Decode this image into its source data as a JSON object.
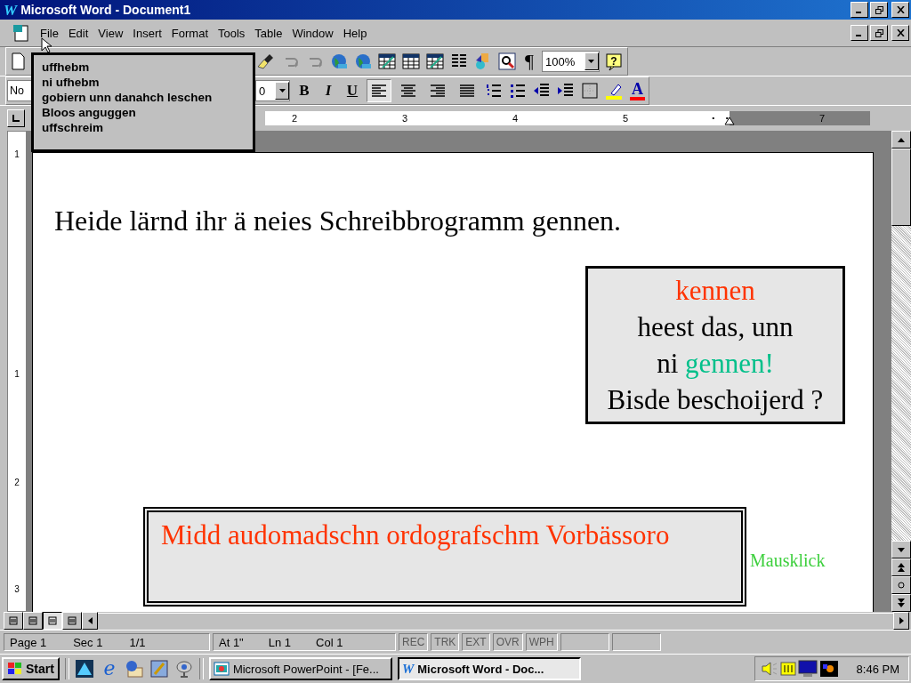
{
  "window": {
    "title": "Microsoft Word - Document1"
  },
  "logo": "W",
  "menu": [
    {
      "label": "File"
    },
    {
      "label": "Edit"
    },
    {
      "label": "View"
    },
    {
      "label": "Insert"
    },
    {
      "label": "Format"
    },
    {
      "label": "Tools"
    },
    {
      "label": "Table"
    },
    {
      "label": "Window"
    },
    {
      "label": "Help"
    }
  ],
  "toolbar": {
    "pilcrow": "¶",
    "zoom": "100%",
    "help": "?"
  },
  "formatting": {
    "style": "No",
    "size": "0",
    "bold": "B",
    "italic": "I",
    "underline": "U",
    "font_color_letter": "A",
    "align": [
      {
        "selected": true
      },
      {
        "selected": false
      },
      {
        "selected": false
      },
      {
        "selected": false
      }
    ]
  },
  "popup": {
    "lines": [
      "uffhebm",
      "ni ufhebm",
      "gobiern unn danahch leschen",
      "Bloos anguggen",
      "uffschreim"
    ]
  },
  "ruler": {
    "numbers": [
      "2",
      "3",
      "4",
      "5",
      "7"
    ]
  },
  "vertical_ruler": {
    "numbers": [
      "1",
      "1",
      "2",
      "3"
    ]
  },
  "document": {
    "heading": "Heide lärnd ihr ä neies Schreibbrogramm gennen.",
    "callout": {
      "lines": [
        [
          {
            "text": "kennen",
            "color": "#ff3300"
          }
        ],
        [
          {
            "text": "heest das, unn",
            "color": "#000000"
          }
        ],
        [
          {
            "text": "ni ",
            "color": "#000000"
          },
          {
            "text": "gennen!",
            "color": "#00c08a"
          }
        ],
        [
          {
            "text": "Bisde beschoijerd ?",
            "color": "#000000"
          }
        ]
      ]
    },
    "banner": "Midd audomadschn ordografschm Vorbässoro",
    "click_hint": "Mausklick"
  },
  "view_buttons": [
    {
      "selected": false
    },
    {
      "selected": false
    },
    {
      "selected": true
    },
    {
      "selected": false
    }
  ],
  "status_bar": {
    "page": "Page 1",
    "sec": "Sec 1",
    "pages": "1/1",
    "at": "At 1\"",
    "ln": "Ln 1",
    "col": "Col 1",
    "indicators": [
      {
        "label": "REC",
        "on": false
      },
      {
        "label": "TRK",
        "on": false
      },
      {
        "label": "EXT",
        "on": false
      },
      {
        "label": "OVR",
        "on": false
      },
      {
        "label": "WPH",
        "on": false
      }
    ]
  },
  "taskbar": {
    "start": "Start",
    "browser_glyph": "e",
    "tasks": [
      {
        "label": "Microsoft PowerPoint - [Fe...",
        "selected": false,
        "kind": "powerpoint"
      },
      {
        "label": "Microsoft Word - Doc...",
        "selected": true,
        "kind": "word",
        "glyph": "W"
      }
    ],
    "time": "8:46 PM"
  }
}
